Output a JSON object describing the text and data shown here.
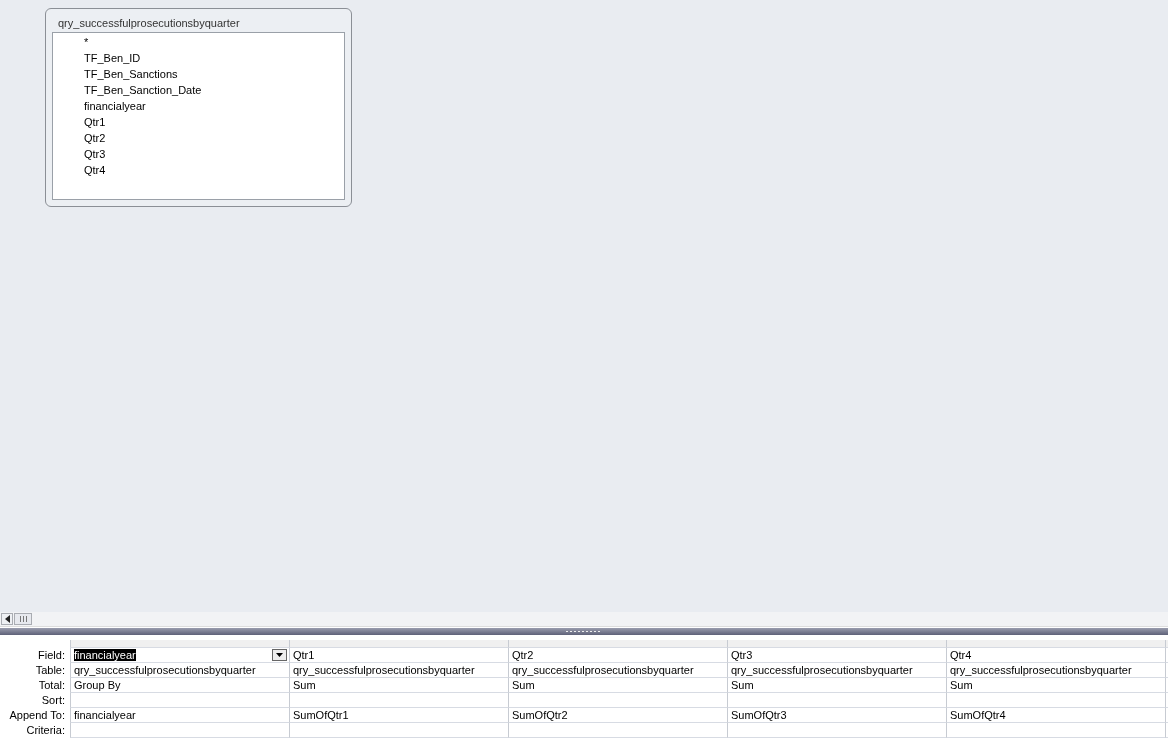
{
  "field_list": {
    "title": "qry_successfulprosecutionsbyquarter",
    "fields": [
      "*",
      "TF_Ben_ID",
      "TF_Ben_Sanctions",
      "TF_Ben_Sanction_Date",
      "financialyear",
      "Qtr1",
      "Qtr2",
      "Qtr3",
      "Qtr4"
    ]
  },
  "grid": {
    "row_labels": [
      "Field:",
      "Table:",
      "Total:",
      "Sort:",
      "Append To:",
      "Criteria:"
    ],
    "columns": [
      {
        "field": "financialyear",
        "table": "qry_successfulprosecutionsbyquarter",
        "total": "Group By",
        "append_to": "financialyear",
        "selected": true
      },
      {
        "field": "Qtr1",
        "table": "qry_successfulprosecutionsbyquarter",
        "total": "Sum",
        "append_to": "SumOfQtr1",
        "selected": false
      },
      {
        "field": "Qtr2",
        "table": "qry_successfulprosecutionsbyquarter",
        "total": "Sum",
        "append_to": "SumOfQtr2",
        "selected": false
      },
      {
        "field": "Qtr3",
        "table": "qry_successfulprosecutionsbyquarter",
        "total": "Sum",
        "append_to": "SumOfQtr3",
        "selected": false
      },
      {
        "field": "Qtr4",
        "table": "qry_successfulprosecutionsbyquarter",
        "total": "Sum",
        "append_to": "SumOfQtr4",
        "selected": false
      }
    ]
  }
}
